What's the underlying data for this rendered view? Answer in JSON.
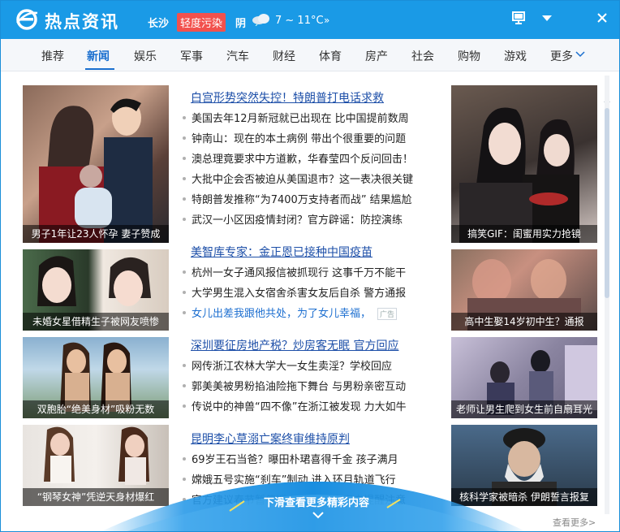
{
  "header": {
    "brand": "热点资讯",
    "city": "长沙",
    "aqi": "轻度污染",
    "weather": "阴",
    "temp": "7 ~ 11°C",
    "temp_more": "»",
    "icons": [
      "ie-logo-icon",
      "cloud-icon",
      "monitor-icon",
      "menu-down-icon",
      "close-icon"
    ]
  },
  "nav": {
    "items": [
      "推荐",
      "新闻",
      "娱乐",
      "军事",
      "汽车",
      "财经",
      "体育",
      "房产",
      "社会",
      "购物",
      "游戏",
      "更多"
    ],
    "active": "新闻"
  },
  "rows": [
    {
      "left_caption": "男子1年让23人怀孕 妻子赞成",
      "headline": "白宫形势突然失控！特朗普打电话求救",
      "news": [
        "美国去年12月新冠就已出现在 比中国提前数周",
        "钟南山：现在的本土病例 带出个很重要的问题",
        "澳总理竟要求中方道歉，华春莹四个反问回击！",
        "大批中企会否被迫从美国退市？这一表决很关键",
        "特朗普发推称“为7400万支持者而战” 结果尴尬",
        "武汉一小区因疫情封闭？官方辟谣：防控演练"
      ],
      "right_caption": "搞笑GIF：闺蜜用实力抢镜"
    },
    {
      "left_caption": "未婚女星借精生子被网友喷惨",
      "headline": "美智库专家：金正恩已接种中国疫苗",
      "news": [
        "杭州一女子通风报信被抓现行 这事千万不能干",
        "大学男生混入女宿舍杀害女友后自杀 警方通报",
        "女儿出差我跟他共处，为了女儿幸福，"
      ],
      "ad_tag": "广告",
      "right_caption": "高中生娶14岁初中生？通报"
    },
    {
      "left_caption": "双胞胎“绝美身材”吸粉无数",
      "headline": "深圳要征房地产税？炒房客无眠 官方回应",
      "news": [
        "网传浙江农林大学大一女生卖淫？学校回应",
        "郭美美被男粉掐油险拖下舞台 与男粉亲密互动",
        "传说中的神兽“四不像”在浙江被发现 力大如牛"
      ],
      "right_caption": "老师让男生爬到女生前自扇耳光"
    },
    {
      "left_caption": "“钢琴女神”凭逆天身材爆红",
      "headline": "昆明李心草溺亡案终审维持原判",
      "news": [
        "69岁王石当爸？曝田朴珺喜得千金 孩子满月",
        "嫦娥五号实施“刹车”制动 进入环月轨道飞行",
        "官方建议春节暂停返乡 实为谣言官方提醒注意"
      ],
      "right_caption": "核科学家被暗杀 伊朗誓言报复"
    }
  ],
  "footer": {
    "scroll_hint": "下滑查看更多精彩内容",
    "see_more": "查看更多>"
  },
  "colors": {
    "titlebar": "#1a9ae6",
    "accent": "#1a6fcf",
    "aqi_badge": "#f2514d",
    "headline": "#1d4fa8"
  }
}
